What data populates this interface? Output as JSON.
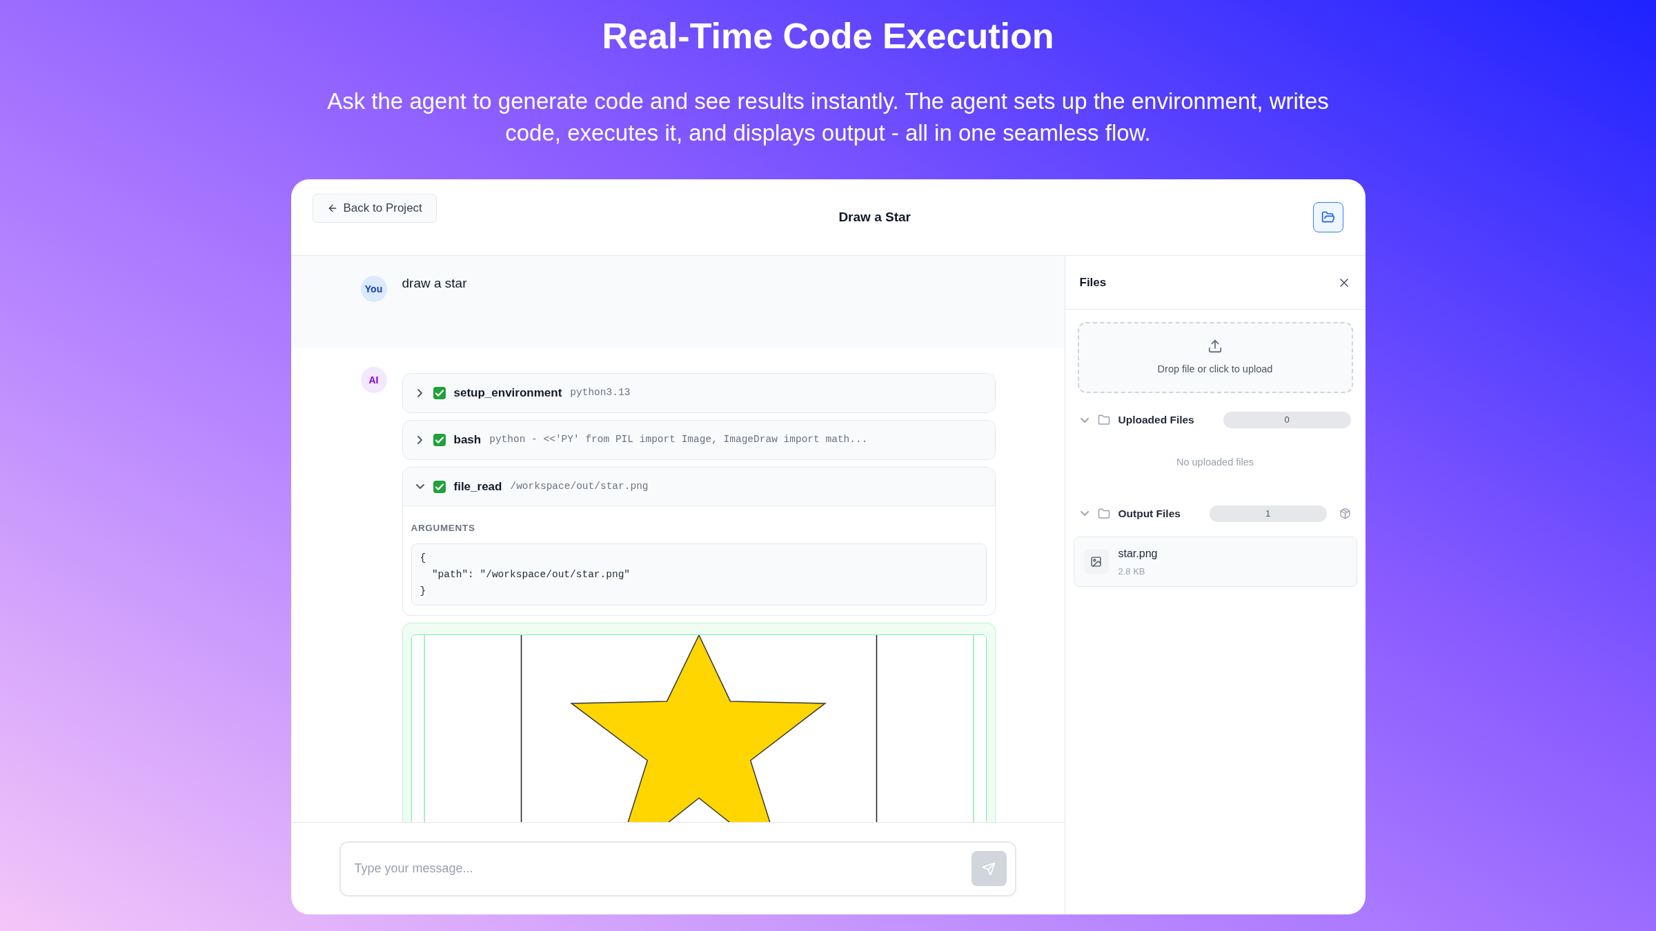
{
  "hero": {
    "title": "Real-Time Code Execution",
    "subtitle": "Ask the agent to generate code and see results instantly. The agent sets up the environment, writes code, executes it, and displays output - all in one seamless flow."
  },
  "header": {
    "back_button": "Back to Project",
    "title": "Draw a Star"
  },
  "messages": [
    {
      "kind": "user",
      "avatar": "You",
      "text": "draw a star"
    },
    {
      "kind": "assistant",
      "avatar": "AI",
      "tools": [
        {
          "name": "setup_environment",
          "summary": "python3.13",
          "done": true,
          "expanded": false
        },
        {
          "name": "bash",
          "summary": "python - <<'PY' from PIL import Image, ImageDraw import math...",
          "done": true,
          "expanded": false
        },
        {
          "name": "file_read",
          "summary": "/workspace/out/star.png",
          "done": true,
          "expanded": true,
          "arguments_label": "ARGUMENTS",
          "arguments": [
            "{",
            "  \"path\": \"/workspace/out/star.png\"",
            "}"
          ]
        }
      ]
    }
  ],
  "composer": {
    "placeholder": "Type your message...",
    "send_disabled": true
  },
  "files_panel": {
    "title": "Files",
    "upload_text": "Drop file or click to upload",
    "sections": [
      {
        "title": "Uploaded Files",
        "count": "0",
        "expanded": true,
        "empty_text": "No uploaded files"
      },
      {
        "title": "Output Files",
        "count": "1",
        "expanded": true,
        "archive_button": true,
        "files": [
          {
            "name": "star.png",
            "size": "2.8 KB"
          }
        ]
      }
    ]
  }
}
